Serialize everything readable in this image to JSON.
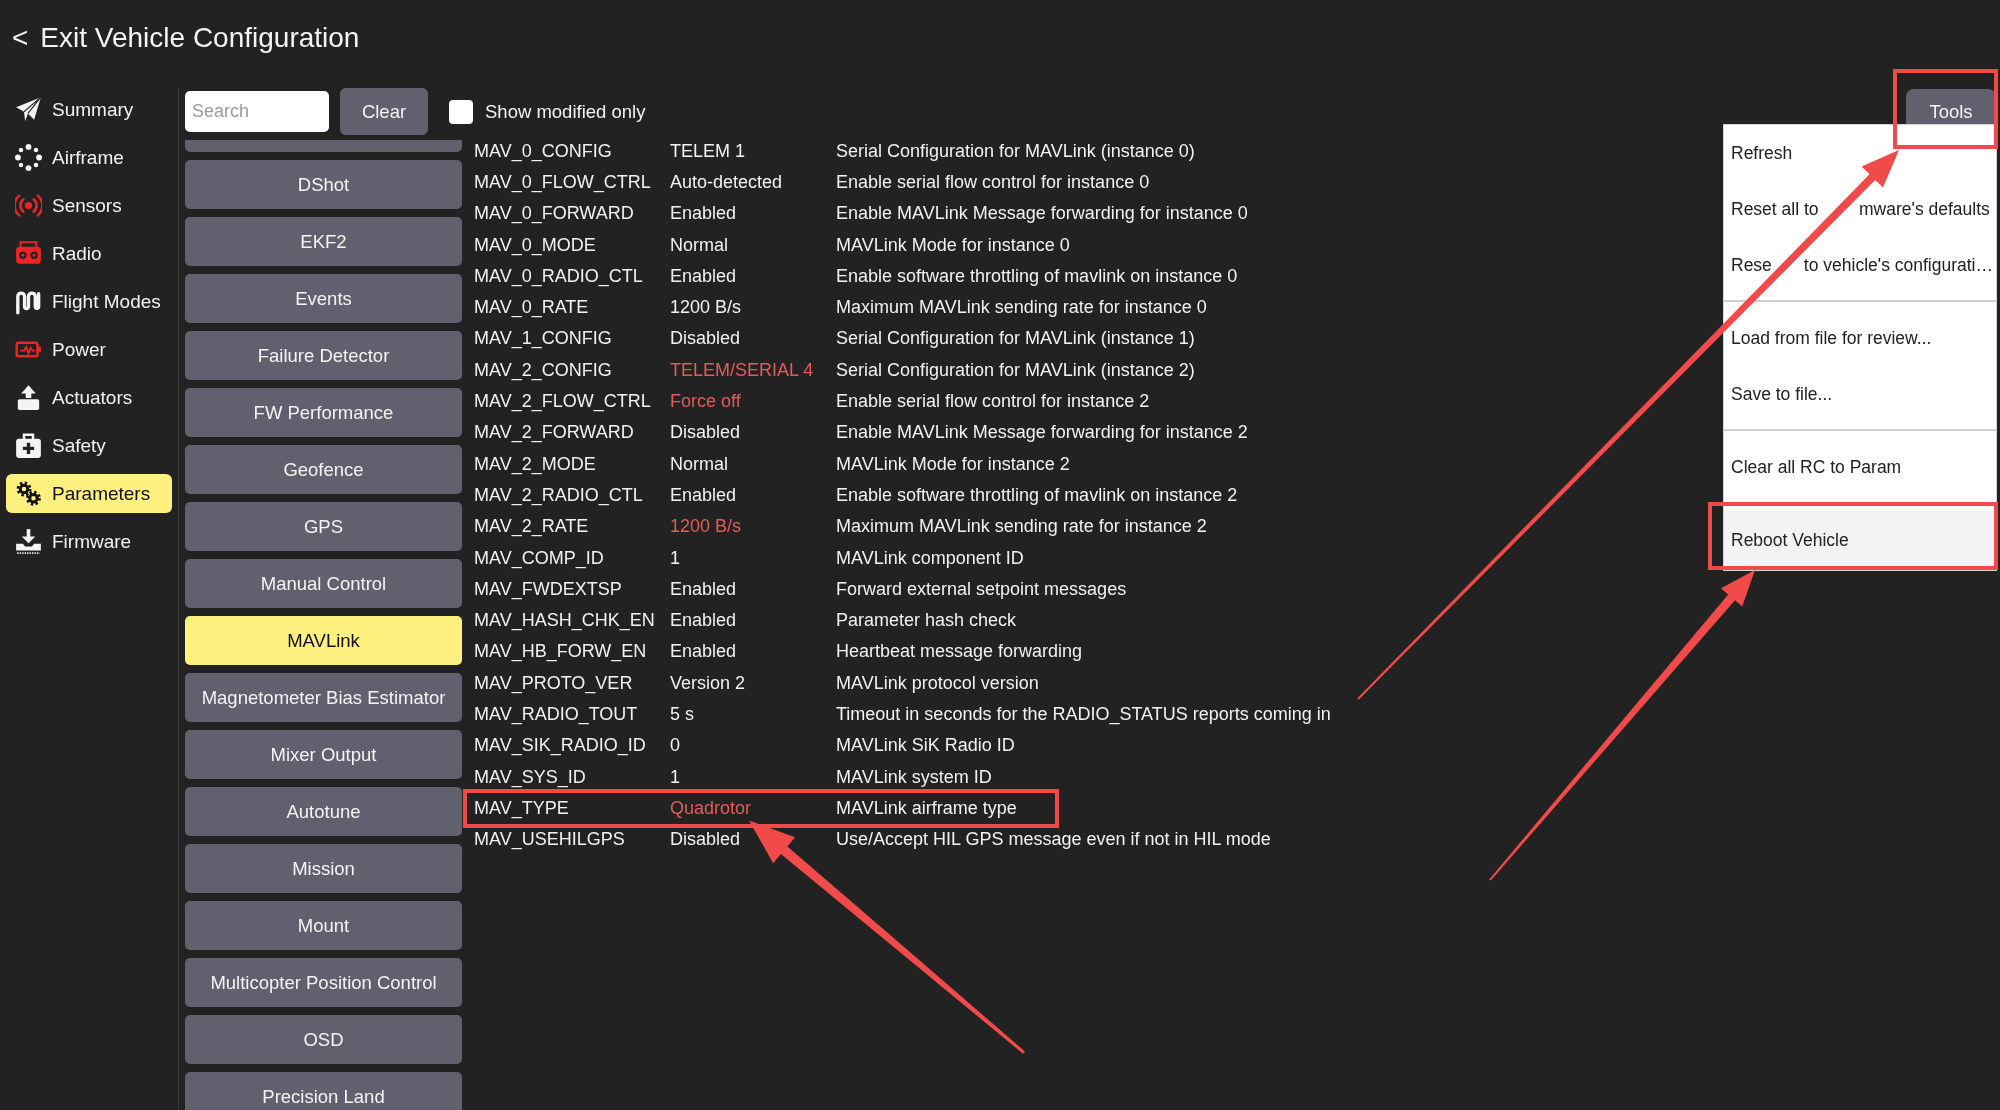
{
  "header": {
    "back_glyph": "<",
    "title": "Exit Vehicle Configuration"
  },
  "sidebar": {
    "items": [
      {
        "label": "Summary",
        "selected": false,
        "needs_setup": false
      },
      {
        "label": "Airframe",
        "selected": false,
        "needs_setup": false
      },
      {
        "label": "Sensors",
        "selected": false,
        "needs_setup": true
      },
      {
        "label": "Radio",
        "selected": false,
        "needs_setup": true
      },
      {
        "label": "Flight Modes",
        "selected": false,
        "needs_setup": false
      },
      {
        "label": "Power",
        "selected": false,
        "needs_setup": true
      },
      {
        "label": "Actuators",
        "selected": false,
        "needs_setup": false
      },
      {
        "label": "Safety",
        "selected": false,
        "needs_setup": false
      },
      {
        "label": "Parameters",
        "selected": true,
        "needs_setup": false
      },
      {
        "label": "Firmware",
        "selected": false,
        "needs_setup": false
      }
    ]
  },
  "toolbar": {
    "search": {
      "placeholder": "Search"
    },
    "clear_button": "Clear",
    "show_modified_only": {
      "label": "Show modified only",
      "checked": false
    },
    "tools": {
      "label": "Tools",
      "annotated": true,
      "menu": [
        {
          "kind": "action",
          "label": "Refresh",
          "hovered": false,
          "annotated": false
        },
        {
          "kind": "action",
          "label_parts": [
            "Reset all to",
            "mware's defaults"
          ],
          "hovered": false,
          "annotated": false
        },
        {
          "kind": "action",
          "label_parts": [
            "Rese",
            "to vehicle's configurati…"
          ],
          "hovered": false,
          "annotated": false
        },
        {
          "kind": "separator"
        },
        {
          "kind": "action",
          "label": "Load from file for review...",
          "hovered": false,
          "annotated": false
        },
        {
          "kind": "action",
          "label": "Save to file...",
          "hovered": false,
          "annotated": false
        },
        {
          "kind": "separator"
        },
        {
          "kind": "action",
          "label": "Clear all RC to Param",
          "hovered": false,
          "annotated": false
        },
        {
          "kind": "action",
          "label": "Reboot Vehicle",
          "hovered": true,
          "annotated": true
        }
      ]
    }
  },
  "categories": {
    "scrolled_above": true,
    "items": [
      {
        "label": "DShot",
        "selected": false
      },
      {
        "label": "EKF2",
        "selected": false
      },
      {
        "label": "Events",
        "selected": false
      },
      {
        "label": "Failure Detector",
        "selected": false
      },
      {
        "label": "FW Performance",
        "selected": false
      },
      {
        "label": "Geofence",
        "selected": false
      },
      {
        "label": "GPS",
        "selected": false
      },
      {
        "label": "Manual Control",
        "selected": false
      },
      {
        "label": "MAVLink",
        "selected": true
      },
      {
        "label": "Magnetometer Bias Estimator",
        "selected": false
      },
      {
        "label": "Mixer Output",
        "selected": false
      },
      {
        "label": "Autotune",
        "selected": false
      },
      {
        "label": "Mission",
        "selected": false
      },
      {
        "label": "Mount",
        "selected": false
      },
      {
        "label": "Multicopter Position Control",
        "selected": false
      },
      {
        "label": "OSD",
        "selected": false
      },
      {
        "label": "Precision Land",
        "selected": false
      }
    ]
  },
  "params": {
    "rows": [
      {
        "name": "MAV_0_CONFIG",
        "value": "TELEM 1",
        "description": "Serial Configuration for MAVLink (instance 0)",
        "modified": false,
        "annotated": false
      },
      {
        "name": "MAV_0_FLOW_CTRL",
        "value": "Auto-detected",
        "description": "Enable serial flow control for instance 0",
        "modified": false,
        "annotated": false
      },
      {
        "name": "MAV_0_FORWARD",
        "value": "Enabled",
        "description": "Enable MAVLink Message forwarding for instance 0",
        "modified": false,
        "annotated": false
      },
      {
        "name": "MAV_0_MODE",
        "value": "Normal",
        "description": "MAVLink Mode for instance 0",
        "modified": false,
        "annotated": false
      },
      {
        "name": "MAV_0_RADIO_CTL",
        "value": "Enabled",
        "description": "Enable software throttling of mavlink on instance 0",
        "modified": false,
        "annotated": false
      },
      {
        "name": "MAV_0_RATE",
        "value": "1200 B/s",
        "description": "Maximum MAVLink sending rate for instance 0",
        "modified": false,
        "annotated": false
      },
      {
        "name": "MAV_1_CONFIG",
        "value": "Disabled",
        "description": "Serial Configuration for MAVLink (instance 1)",
        "modified": false,
        "annotated": false
      },
      {
        "name": "MAV_2_CONFIG",
        "value": "TELEM/SERIAL 4",
        "description": "Serial Configuration for MAVLink (instance 2)",
        "modified": true,
        "annotated": false
      },
      {
        "name": "MAV_2_FLOW_CTRL",
        "value": "Force off",
        "description": "Enable serial flow control for instance 2",
        "modified": true,
        "annotated": false
      },
      {
        "name": "MAV_2_FORWARD",
        "value": "Disabled",
        "description": "Enable MAVLink Message forwarding for instance 2",
        "modified": false,
        "annotated": false
      },
      {
        "name": "MAV_2_MODE",
        "value": "Normal",
        "description": "MAVLink Mode for instance 2",
        "modified": false,
        "annotated": false
      },
      {
        "name": "MAV_2_RADIO_CTL",
        "value": "Enabled",
        "description": "Enable software throttling of mavlink on instance 2",
        "modified": false,
        "annotated": false
      },
      {
        "name": "MAV_2_RATE",
        "value": "1200 B/s",
        "description": "Maximum MAVLink sending rate for instance 2",
        "modified": true,
        "annotated": false
      },
      {
        "name": "MAV_COMP_ID",
        "value": "1",
        "description": "MAVLink component ID",
        "modified": false,
        "annotated": false
      },
      {
        "name": "MAV_FWDEXTSP",
        "value": "Enabled",
        "description": "Forward external setpoint messages",
        "modified": false,
        "annotated": false
      },
      {
        "name": "MAV_HASH_CHK_EN",
        "value": "Enabled",
        "description": "Parameter hash check",
        "modified": false,
        "annotated": false
      },
      {
        "name": "MAV_HB_FORW_EN",
        "value": "Enabled",
        "description": "Heartbeat message forwarding",
        "modified": false,
        "annotated": false
      },
      {
        "name": "MAV_PROTO_VER",
        "value": "Version 2",
        "description": "MAVLink protocol version",
        "modified": false,
        "annotated": false
      },
      {
        "name": "MAV_RADIO_TOUT",
        "value": "5 s",
        "description": "Timeout in seconds for the RADIO_STATUS reports coming in",
        "modified": false,
        "annotated": false
      },
      {
        "name": "MAV_SIK_RADIO_ID",
        "value": "0",
        "description": "MAVLink SiK Radio ID",
        "modified": false,
        "annotated": false
      },
      {
        "name": "MAV_SYS_ID",
        "value": "1",
        "description": "MAVLink system ID",
        "modified": false,
        "annotated": false
      },
      {
        "name": "MAV_TYPE",
        "value": "Quadrotor",
        "description": "MAVLink airframe type",
        "modified": true,
        "annotated": true
      },
      {
        "name": "MAV_USEHILGPS",
        "value": "Disabled",
        "description": "Use/Accept HIL GPS message even if not in HIL mode",
        "modified": false,
        "annotated": false
      }
    ]
  }
}
